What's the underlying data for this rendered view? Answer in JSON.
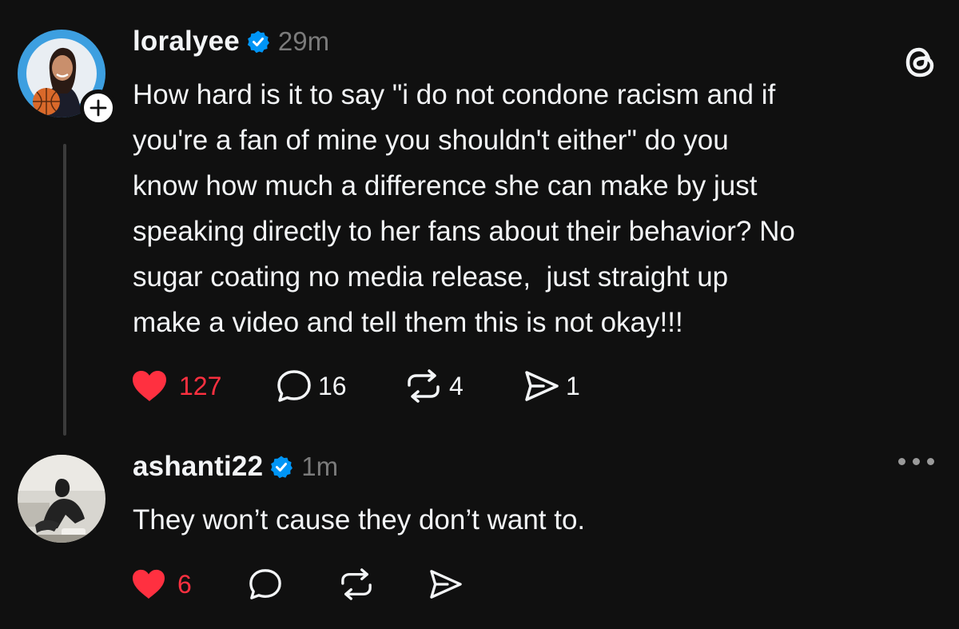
{
  "colors": {
    "background": "#101010",
    "text": "#f3f5f7",
    "muted": "#7b7b7b",
    "like": "#ff3040",
    "verified": "#0095f6"
  },
  "posts": [
    {
      "username": "loralyee",
      "verified": true,
      "time": "29m",
      "follow_badge": "+",
      "avatar_icon": "user-photo",
      "text": "How hard is it to say \"i do not condone racism and if\nyou're a fan of mine you shouldn't either\" do you\nknow how much a difference she can make by just\nspeaking directly to her fans about their behavior? No\nsugar coating no media release,  just straight up\nmake a video and tell them this is not okay!!!",
      "likes": "127",
      "replies": "16",
      "reposts": "4",
      "shares": "1",
      "liked": true
    },
    {
      "username": "ashanti22",
      "verified": true,
      "time": "1m",
      "avatar_icon": "user-photo",
      "text": "They won’t cause they don’t want to.",
      "likes": "6",
      "liked": true
    }
  ],
  "icons": {
    "app_logo": "threads-logo-icon",
    "more": "more-options-icon",
    "like": "heart-icon",
    "reply": "comment-icon",
    "repost": "repost-icon",
    "share": "send-icon"
  }
}
